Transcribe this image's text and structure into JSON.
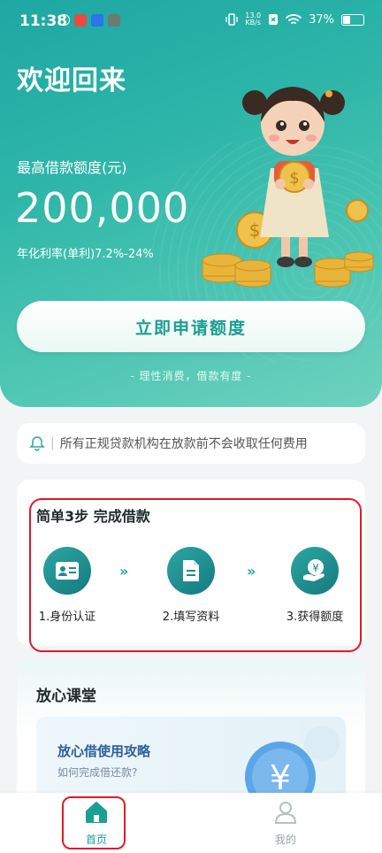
{
  "status_bar": {
    "time": "11:38",
    "net_speed_value": "13.0",
    "net_speed_unit": "KB/s",
    "battery": "37%"
  },
  "hero": {
    "welcome": "欢迎回来",
    "limit_label": "最高借款额度(元)",
    "limit_amount": "200,000",
    "rate": "年化利率(单利)7.2%-24%",
    "apply_button": "立即申请额度",
    "slogan": "- 理性消费，借款有度 -"
  },
  "notice": {
    "text": "所有正规贷款机构在放款前不会收取任何费用"
  },
  "steps": {
    "title": "简单3步 完成借款",
    "items": [
      {
        "label": "1.身份认证",
        "icon": "id-card-icon"
      },
      {
        "label": "2.填写资料",
        "icon": "document-icon"
      },
      {
        "label": "3.获得额度",
        "icon": "yuan-hand-icon"
      }
    ],
    "arrow": "»"
  },
  "course": {
    "title": "放心课堂",
    "banner_title": "放心借使用攻略",
    "banner_sub": "如何完成借还款?",
    "currency_symbol": "¥"
  },
  "tabbar": {
    "items": [
      {
        "label": "首页",
        "icon": "home-icon",
        "active": true
      },
      {
        "label": "我的",
        "icon": "user-icon",
        "active": false
      }
    ]
  },
  "colors": {
    "accent": "#1a9f93",
    "highlight": "#e0192b"
  }
}
